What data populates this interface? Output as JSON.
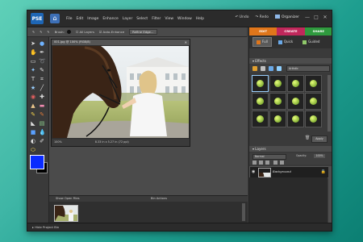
{
  "menubar": {
    "app_logo": "PSE",
    "items": [
      "File",
      "Edit",
      "Image",
      "Enhance",
      "Layer",
      "Select",
      "Filter",
      "View",
      "Window",
      "Help"
    ],
    "undo": "Undo",
    "redo": "Redo",
    "organizer": "Organizer"
  },
  "options_bar": {
    "brush_label": "Brush:",
    "all_layers": "All Layers",
    "auto_enhance": "Auto-Enhance",
    "refine_edge": "Refine Edge..."
  },
  "document": {
    "title": "001.jpg @ 100% (RGB/8)",
    "zoom": "100%",
    "size_info": "8.33 in x 5.27 in (72 ppi)"
  },
  "project_bin": {
    "show_label": "Show Open Files",
    "actions_label": "Bin Actions"
  },
  "bottom_bar": {
    "hide_label": "Hide Project Bin"
  },
  "right_panel": {
    "mode_tabs": [
      {
        "label": "EDIT",
        "color": "#e0761b"
      },
      {
        "label": "CREATE",
        "color": "#c0285b"
      },
      {
        "label": "SHARE",
        "color": "#2f9a3e"
      }
    ],
    "sub_tabs": [
      "Full",
      "Quick",
      "Guided"
    ],
    "effects_title": "Effects",
    "effects_dropdown": "Artistic",
    "apply_label": "Apply",
    "layers_title": "Layers",
    "blend_mode": "Normal",
    "opacity_label": "Opacity:",
    "opacity_value": "100%",
    "layer_name": "Background"
  }
}
